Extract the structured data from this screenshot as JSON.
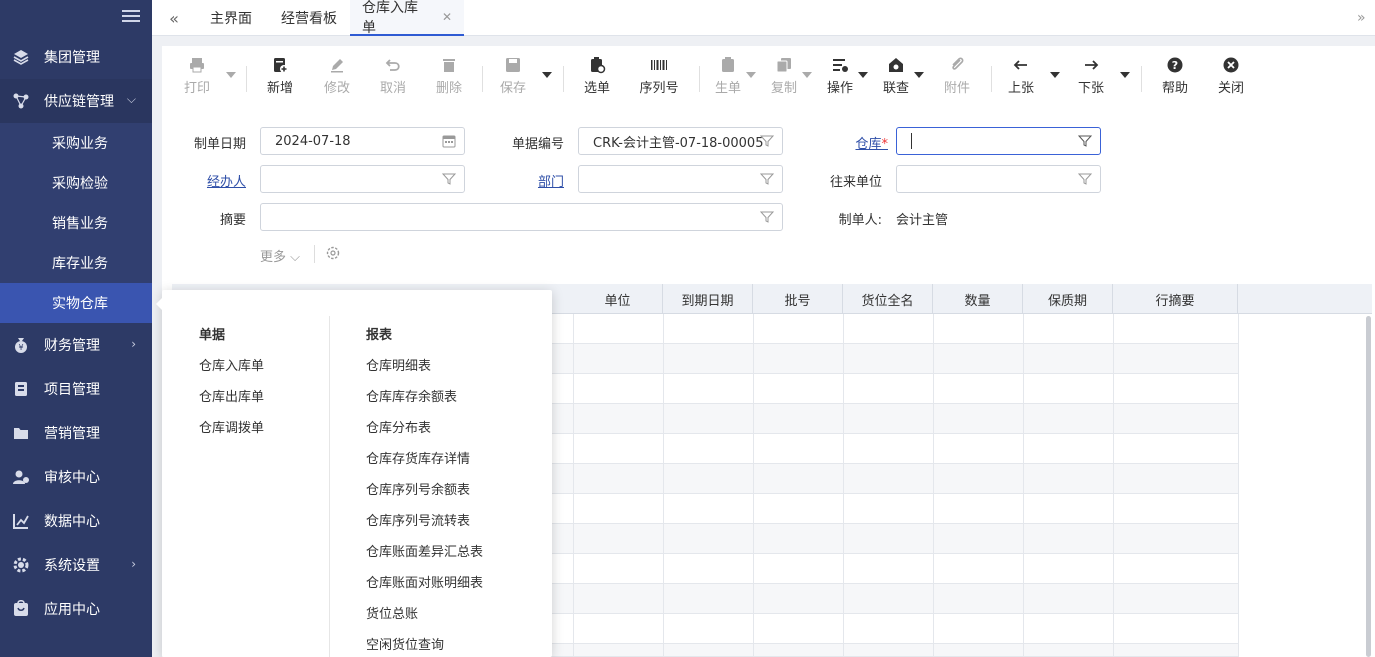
{
  "sidebar": {
    "items": [
      {
        "label": "集团管理",
        "icon": "layers-icon"
      },
      {
        "label": "供应链管理",
        "icon": "supply-chain-icon"
      },
      {
        "label": "财务管理",
        "icon": "money-bag-icon"
      },
      {
        "label": "项目管理",
        "icon": "project-icon"
      },
      {
        "label": "营销管理",
        "icon": "folder-icon"
      },
      {
        "label": "审核中心",
        "icon": "audit-icon"
      },
      {
        "label": "数据中心",
        "icon": "chart-icon"
      },
      {
        "label": "系统设置",
        "icon": "gear-icon"
      },
      {
        "label": "应用中心",
        "icon": "app-icon"
      }
    ],
    "sub_items": [
      "采购业务",
      "采购检验",
      "销售业务",
      "库存业务",
      "实物仓库"
    ]
  },
  "tabs": [
    {
      "label": "主界面"
    },
    {
      "label": "经营看板"
    },
    {
      "label": "仓库入库单"
    }
  ],
  "toolbar": {
    "print": "打印",
    "new": "新增",
    "edit": "修改",
    "cancel": "取消",
    "delete": "删除",
    "save": "保存",
    "select": "选单",
    "serial": "序列号",
    "generate": "生单",
    "copy": "复制",
    "operate": "操作",
    "query": "联查",
    "attach": "附件",
    "prev": "上张",
    "next": "下张",
    "help": "帮助",
    "close": "关闭"
  },
  "form": {
    "date_label": "制单日期",
    "date_value": "2024-07-18",
    "doc_no_label": "单据编号",
    "doc_no_value": "CRK-会计主管-07-18-00005",
    "warehouse_label": "仓库",
    "warehouse_required": "*",
    "handler_label": "经办人",
    "dept_label": "部门",
    "partner_label": "往来单位",
    "summary_label": "摘要",
    "creator_label": "制单人:",
    "creator_value": "会计主管",
    "more": "更多"
  },
  "grid": {
    "headers": [
      "单位",
      "到期日期",
      "批号",
      "货位全名",
      "数量",
      "保质期",
      "行摘要"
    ]
  },
  "dropdown": {
    "docs_title": "单据",
    "docs": [
      "仓库入库单",
      "仓库出库单",
      "仓库调拨单"
    ],
    "reports_title": "报表",
    "reports": [
      "仓库明细表",
      "仓库库存余额表",
      "仓库分布表",
      "仓库存货库存详情",
      "仓库序列号余额表",
      "仓库序列号流转表",
      "仓库账面差异汇总表",
      "仓库账面对账明细表",
      "货位总账",
      "空闲货位查询"
    ]
  }
}
